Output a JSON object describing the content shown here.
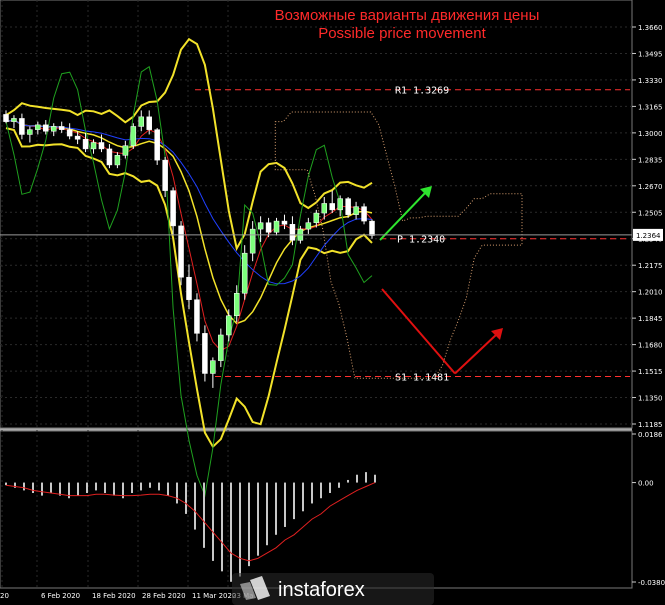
{
  "chart_data": {
    "type": "candlestick",
    "title_ru": "Возможные варианты движения цены",
    "title_en": "Possible price movement",
    "price_axis": {
      "ticks": [
        "1.3660",
        "1.3495",
        "1.3330",
        "1.3165",
        "1.3000",
        "1.2835",
        "1.2670",
        "1.2505",
        "1.2340",
        "1.2175",
        "1.2010",
        "1.1845",
        "1.1680",
        "1.1515",
        "1.1350",
        "1.1185"
      ],
      "current_price": "1.2364",
      "ylim": [
        1.1185,
        1.366
      ]
    },
    "levels": [
      {
        "name": "R1",
        "value": "1.3269",
        "color": "#ff3030"
      },
      {
        "name": "P",
        "value": "1.2340",
        "color": "#ff3030"
      },
      {
        "name": "S1",
        "value": "1.1481",
        "color": "#ff3030"
      }
    ],
    "date_labels": [
      "20",
      "6 Feb 2020",
      "18 Feb 2020",
      "28 Feb 2020",
      "11 Mar 2020",
      "23 Ma"
    ],
    "oscillator": {
      "ticks": [
        "0.0186",
        "0.00",
        "-0.03808"
      ],
      "histogram": [
        -0.001,
        -0.002,
        -0.003,
        -0.004,
        -0.005,
        -0.004,
        -0.005,
        -0.006,
        -0.005,
        -0.004,
        -0.003,
        -0.004,
        -0.005,
        -0.006,
        -0.004,
        -0.003,
        -0.002,
        -0.003,
        -0.005,
        -0.008,
        -0.012,
        -0.018,
        -0.025,
        -0.03,
        -0.034,
        -0.038,
        -0.036,
        -0.032,
        -0.028,
        -0.024,
        -0.02,
        -0.017,
        -0.014,
        -0.011,
        -0.008,
        -0.006,
        -0.004,
        -0.002,
        0.001,
        0.003,
        0.004,
        0.003
      ],
      "signal": [
        -0.001,
        -0.0015,
        -0.002,
        -0.003,
        -0.0035,
        -0.004,
        -0.0045,
        -0.005,
        -0.005,
        -0.005,
        -0.0045,
        -0.0045,
        -0.0048,
        -0.005,
        -0.005,
        -0.0048,
        -0.0045,
        -0.0045,
        -0.005,
        -0.006,
        -0.008,
        -0.011,
        -0.015,
        -0.019,
        -0.023,
        -0.027,
        -0.029,
        -0.03,
        -0.029,
        -0.027,
        -0.025,
        -0.022,
        -0.02,
        -0.017,
        -0.014,
        -0.012,
        -0.009,
        -0.007,
        -0.005,
        -0.003,
        -0.0015,
        0
      ]
    },
    "candles": [
      [
        1.3115,
        1.314,
        1.306,
        1.307
      ],
      [
        1.307,
        1.311,
        1.303,
        1.309
      ],
      [
        1.309,
        1.312,
        1.296,
        1.299
      ],
      [
        1.299,
        1.304,
        1.294,
        1.302
      ],
      [
        1.302,
        1.307,
        1.299,
        1.305
      ],
      [
        1.305,
        1.308,
        1.299,
        1.301
      ],
      [
        1.301,
        1.306,
        1.298,
        1.304
      ],
      [
        1.304,
        1.307,
        1.3,
        1.302
      ],
      [
        1.302,
        1.306,
        1.296,
        1.298
      ],
      [
        1.298,
        1.301,
        1.293,
        1.296
      ],
      [
        1.296,
        1.3,
        1.288,
        1.29
      ],
      [
        1.29,
        1.296,
        1.287,
        1.294
      ],
      [
        1.294,
        1.299,
        1.288,
        1.29
      ],
      [
        1.29,
        1.293,
        1.278,
        1.28
      ],
      [
        1.28,
        1.288,
        1.278,
        1.286
      ],
      [
        1.286,
        1.295,
        1.284,
        1.292
      ],
      [
        1.292,
        1.306,
        1.29,
        1.304
      ],
      [
        1.304,
        1.314,
        1.301,
        1.31
      ],
      [
        1.31,
        1.314,
        1.299,
        1.302
      ],
      [
        1.302,
        1.303,
        1.28,
        1.283
      ],
      [
        1.283,
        1.285,
        1.26,
        1.264
      ],
      [
        1.264,
        1.266,
        1.236,
        1.242
      ],
      [
        1.242,
        1.245,
        1.205,
        1.21
      ],
      [
        1.21,
        1.218,
        1.19,
        1.196
      ],
      [
        1.196,
        1.2,
        1.17,
        1.175
      ],
      [
        1.175,
        1.18,
        1.145,
        1.15
      ],
      [
        1.15,
        1.16,
        1.141,
        1.158
      ],
      [
        1.158,
        1.178,
        1.154,
        1.174
      ],
      [
        1.174,
        1.19,
        1.17,
        1.186
      ],
      [
        1.186,
        1.205,
        1.182,
        1.2
      ],
      [
        1.2,
        1.23,
        1.196,
        1.225
      ],
      [
        1.225,
        1.245,
        1.22,
        1.24
      ],
      [
        1.24,
        1.248,
        1.232,
        1.244
      ],
      [
        1.244,
        1.247,
        1.235,
        1.238
      ],
      [
        1.238,
        1.247,
        1.236,
        1.245
      ],
      [
        1.245,
        1.249,
        1.24,
        1.243
      ],
      [
        1.243,
        1.248,
        1.23,
        1.233
      ],
      [
        1.233,
        1.242,
        1.231,
        1.24
      ],
      [
        1.24,
        1.247,
        1.237,
        1.244
      ],
      [
        1.244,
        1.252,
        1.241,
        1.25
      ],
      [
        1.25,
        1.26,
        1.246,
        1.256
      ],
      [
        1.256,
        1.264,
        1.25,
        1.252
      ],
      [
        1.252,
        1.261,
        1.248,
        1.259
      ],
      [
        1.259,
        1.26,
        1.247,
        1.249
      ],
      [
        1.249,
        1.257,
        1.246,
        1.254
      ],
      [
        1.254,
        1.256,
        1.243,
        1.245
      ],
      [
        1.245,
        1.246,
        1.234,
        1.236
      ]
    ]
  },
  "watermark": "instaforex"
}
